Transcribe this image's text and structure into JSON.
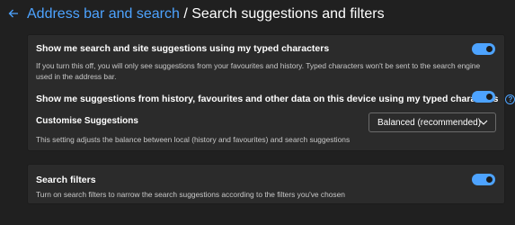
{
  "header": {
    "back_icon": "back-arrow-icon",
    "breadcrumb_parent": "Address bar and search",
    "separator": " / ",
    "breadcrumb_current": "Search suggestions and filters"
  },
  "settings": {
    "typed_characters": {
      "title": "Show me search and site suggestions using my typed characters",
      "description": "If you turn this off, you will only see suggestions from your favourites and history. Typed characters won't be sent to the search engine used in the address bar.",
      "enabled": true
    },
    "device_suggestions": {
      "title": "Show me suggestions from history, favourites and other data on this device using my typed characters",
      "help_icon": "question-circle-icon",
      "enabled": true
    },
    "customise": {
      "title": "Customise Suggestions",
      "description": "This setting adjusts the balance between local (history and favourites) and search suggestions",
      "selected": "Balanced (recommended)"
    },
    "search_filters": {
      "title": "Search filters",
      "description": "Turn on search filters to narrow the search suggestions according to the filters you've chosen",
      "enabled": true
    }
  },
  "colors": {
    "accent": "#4da3ff",
    "background": "#202020",
    "card": "#2b2b2b"
  }
}
